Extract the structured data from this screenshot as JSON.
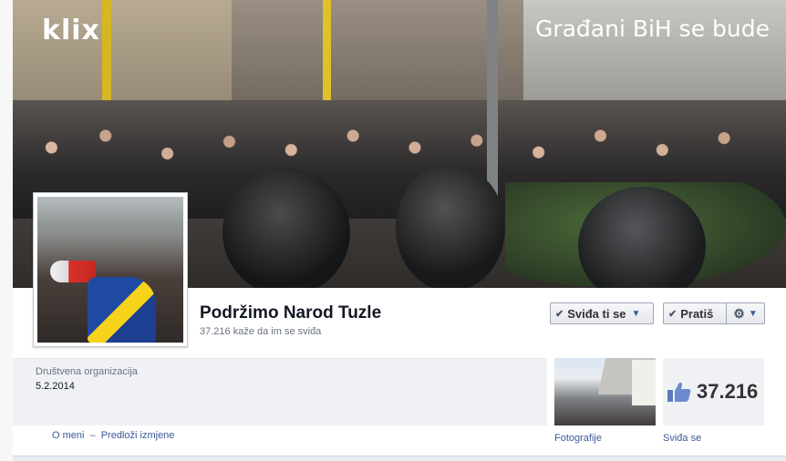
{
  "cover": {
    "brand_logo": "klix",
    "title": "Građani BiH se bude"
  },
  "page": {
    "name": "Podržimo Narod Tuzle",
    "likes_line": "37.216 kaže da im se sviđa"
  },
  "actions": {
    "like_label": "Sviđa ti se",
    "follow_label": "Pratiš",
    "check_icon": "check-icon",
    "caret_icon": "chevron-down-icon",
    "gear_icon": "gear-icon"
  },
  "about": {
    "category": "Društvena organizacija",
    "date": "5.2.2014",
    "links": [
      "O meni",
      "Predloži izmjene"
    ],
    "separator": "–"
  },
  "apps": {
    "photos_label": "Fotografije",
    "likes_count": "37.216",
    "likes_label": "Sviđa se"
  },
  "colors": {
    "link": "#3b5998",
    "name": "#141823",
    "muted": "#6a7180",
    "about_bg": "#eff1f5"
  }
}
